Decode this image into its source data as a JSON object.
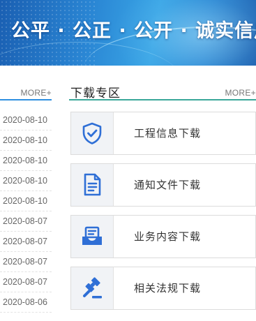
{
  "banner": {
    "slogan": "公平 · 公正 · 公开 · 诚实信用"
  },
  "left_panel": {
    "more_label": "MORE+",
    "dates": [
      "2020-08-10",
      "2020-08-10",
      "2020-08-10",
      "2020-08-10",
      "2020-08-10",
      "2020-08-07",
      "2020-08-07",
      "2020-08-07",
      "2020-08-07",
      "2020-08-06"
    ]
  },
  "download_section": {
    "title": "下载专区",
    "more_label": "MORE+",
    "items": [
      {
        "label": "工程信息下载",
        "icon": "shield-check-icon"
      },
      {
        "label": "通知文件下载",
        "icon": "document-icon"
      },
      {
        "label": "业务内容下载",
        "icon": "inbox-tray-icon"
      },
      {
        "label": "相关法规下载",
        "icon": "gavel-icon"
      }
    ]
  },
  "colors": {
    "icon_blue": "#2f6fd6",
    "left_rule": "#2e8fe0",
    "right_rule": "#3aa79a"
  }
}
